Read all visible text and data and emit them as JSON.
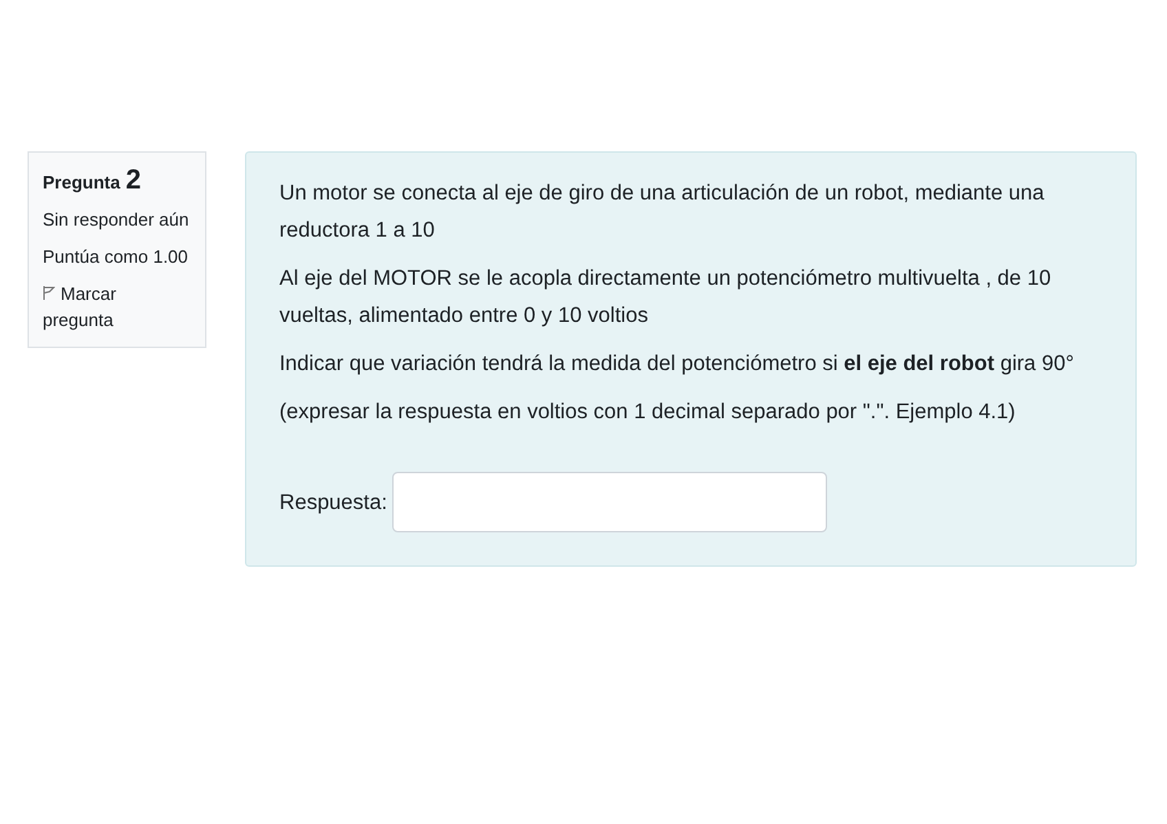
{
  "question_info": {
    "label": "Pregunta",
    "number": "2",
    "status": "Sin responder aún",
    "grade": "Puntúa como 1.00",
    "flag": {
      "label": "Marcar pregunta",
      "flagged": false
    }
  },
  "question": {
    "paragraphs": [
      "Un motor se conecta al eje de giro de una articulación de un robot, mediante una reductora 1 a 10",
      "Al eje del MOTOR se le acopla directamente un potenciómetro multivuelta , de 10 vueltas, alimentado entre 0 y 10 voltios",
      "Indicar que variación tendrá la medida del potenciómetro si **el eje del robot** gira 90°",
      "(expresar la respuesta en voltios con 1 decimal separado por \".\". Ejemplo 4.1)"
    ],
    "answer": {
      "label": "Respuesta:"
    }
  }
}
